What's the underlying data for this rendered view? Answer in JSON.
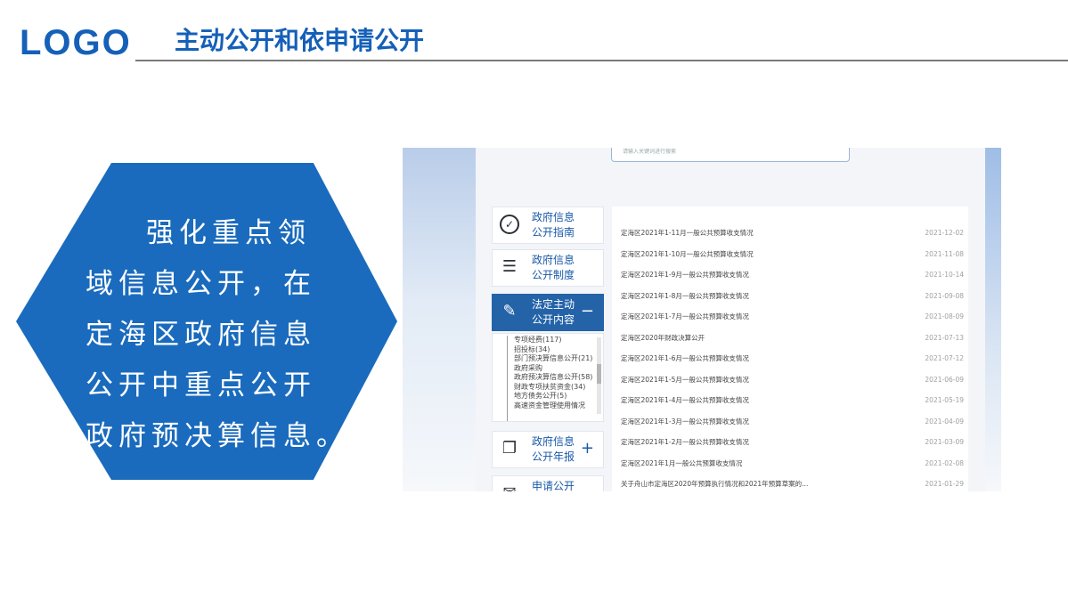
{
  "header": {
    "logo": "LOGO",
    "title": "主动公开和依申请公开"
  },
  "callout": {
    "lines": [
      "强化重点领",
      "域信息公开，在",
      "定海区政府信息",
      "公开中重点公开",
      "政府预决算信息。"
    ]
  },
  "screenshot": {
    "search_placeholder": "请输入关键词进行搜索",
    "nav": [
      {
        "label_1": "政府信息",
        "label_2": "公开指南",
        "icon": "compass-icon",
        "sign": ""
      },
      {
        "label_1": "政府信息",
        "label_2": "公开制度",
        "icon": "document-list-icon",
        "sign": ""
      },
      {
        "label_1": "法定主动",
        "label_2": "公开内容",
        "icon": "clipboard-edit-icon",
        "sign": "−"
      },
      {
        "label_1": "政府信息",
        "label_2": "公开年报",
        "icon": "folder-doc-icon",
        "sign": "+"
      },
      {
        "label_1": "申请公开",
        "label_2": "",
        "icon": "mail-icon",
        "sign": ""
      }
    ],
    "sub_items": [
      "专项经费(117)",
      "招投标(34)",
      "部门预决算信息公开(21)",
      "政府采购",
      "政府预决算信息公开(58)",
      "财政专项扶贫资金(34)",
      "地方债务公开(5)",
      "高速资金管理使用情况"
    ],
    "rows": [
      {
        "title": "定海区2021年1-11月一般公共预算收支情况",
        "date": "2021-12-02"
      },
      {
        "title": "定海区2021年1-10月一般公共预算收支情况",
        "date": "2021-11-08"
      },
      {
        "title": "定海区2021年1-9月一般公共预算收支情况",
        "date": "2021-10-14"
      },
      {
        "title": "定海区2021年1-8月一般公共预算收支情况",
        "date": "2021-09-08"
      },
      {
        "title": "定海区2021年1-7月一般公共预算收支情况",
        "date": "2021-08-09"
      },
      {
        "title": "定海区2020年财政决算公开",
        "date": "2021-07-13"
      },
      {
        "title": "定海区2021年1-6月一般公共预算收支情况",
        "date": "2021-07-12"
      },
      {
        "title": "定海区2021年1-5月一般公共预算收支情况",
        "date": "2021-06-09"
      },
      {
        "title": "定海区2021年1-4月一般公共预算收支情况",
        "date": "2021-05-19"
      },
      {
        "title": "定海区2021年1-3月一般公共预算收支情况",
        "date": "2021-04-09"
      },
      {
        "title": "定海区2021年1-2月一般公共预算收支情况",
        "date": "2021-03-09"
      },
      {
        "title": "定海区2021年1月一般公共预算收支情况",
        "date": "2021-02-08"
      },
      {
        "title": "关于舟山市定海区2020年预算执行情况和2021年预算草案的...",
        "date": "2021-01-29"
      }
    ]
  },
  "colors": {
    "brand_blue": "#1560b8",
    "hexagon": "#1a6bbd",
    "active_nav": "#2463a8"
  }
}
